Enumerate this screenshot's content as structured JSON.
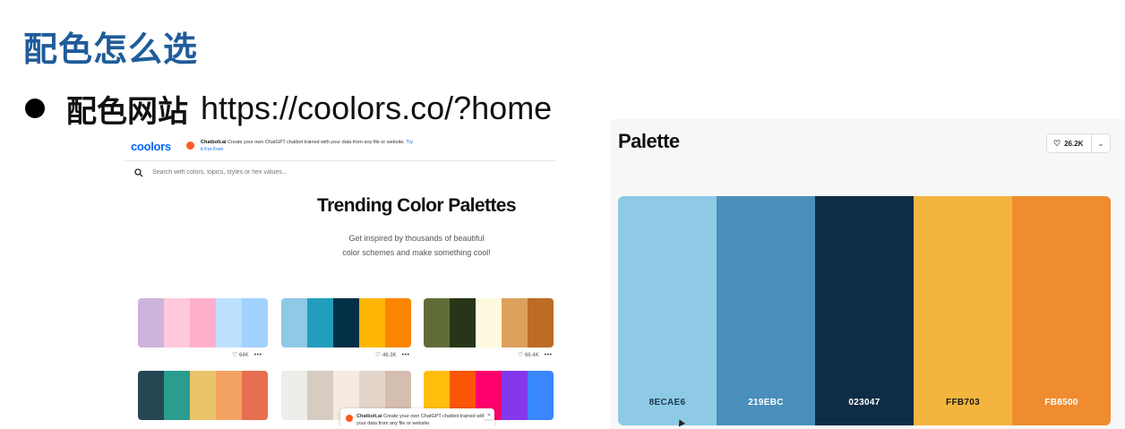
{
  "slide": {
    "title": "配色怎么选",
    "bullet_label": "配色网站",
    "bullet_url": "https://coolors.co/?home"
  },
  "coolors_page": {
    "logo": "coolors",
    "ad": {
      "brand": "Chatbolt.ai",
      "text": "Create your own ChatGPT chatbot trained with your data from any file or website.",
      "link": "Try it For Free"
    },
    "search": {
      "placeholder": "Search with colors, topics, styles or hex values..."
    },
    "heading": "Trending Color Palettes",
    "subtext_line1": "Get inspired by thousands of beautiful",
    "subtext_line2": "color schemes and make something cool!",
    "palettes": [
      {
        "colors": [
          "#cdb4db",
          "#ffc8dd",
          "#ffafcc",
          "#bde0fe",
          "#a2d2ff"
        ],
        "likes": "64K"
      },
      {
        "colors": [
          "#8ecae6",
          "#219ebc",
          "#023047",
          "#ffb703",
          "#fb8500"
        ],
        "likes": "46.3K"
      },
      {
        "colors": [
          "#606c38",
          "#283618",
          "#fefae0",
          "#dda15e",
          "#bc6c25"
        ],
        "likes": "66.4K"
      },
      {
        "colors": [
          "#264653",
          "#2a9d8f",
          "#e9c46a",
          "#f4a261",
          "#e76f51"
        ],
        "likes": ""
      },
      {
        "colors": [
          "#edede9",
          "#d6ccc2",
          "#f5ebe0",
          "#e3d5ca",
          "#d5bdaf"
        ],
        "likes": ""
      },
      {
        "colors": [
          "#ffbe0b",
          "#fb5607",
          "#ff006e",
          "#8338ec",
          "#3a86ff"
        ],
        "likes": ""
      }
    ],
    "toast": {
      "brand": "Chatbolt.ai",
      "text": "Create your own ChatGPT chatbot trained with your data from any file or website.",
      "close": "×"
    }
  },
  "palette_page": {
    "title": "Palette",
    "likes": "26.2K",
    "colors": [
      {
        "hex": "8ECAE6",
        "color": "#8ecae6",
        "label_color": "#1d3a4a"
      },
      {
        "hex": "219EBC",
        "color": "#4a8fbb",
        "label_color": "#ffffff"
      },
      {
        "hex": "023047",
        "color": "#0f2c46",
        "label_color": "#ffffff"
      },
      {
        "hex": "FFB703",
        "color": "#f4b53f",
        "label_color": "#1a1a1a"
      },
      {
        "hex": "FB8500",
        "color": "#ef8c30",
        "label_color": "#ffffff"
      }
    ]
  },
  "icons": {
    "bullet": "bullet-dot",
    "search": "search-icon",
    "heart": "heart-icon",
    "more": "more-icon",
    "chevron": "chevron-down-icon",
    "cursor": "mouse-cursor-icon"
  }
}
